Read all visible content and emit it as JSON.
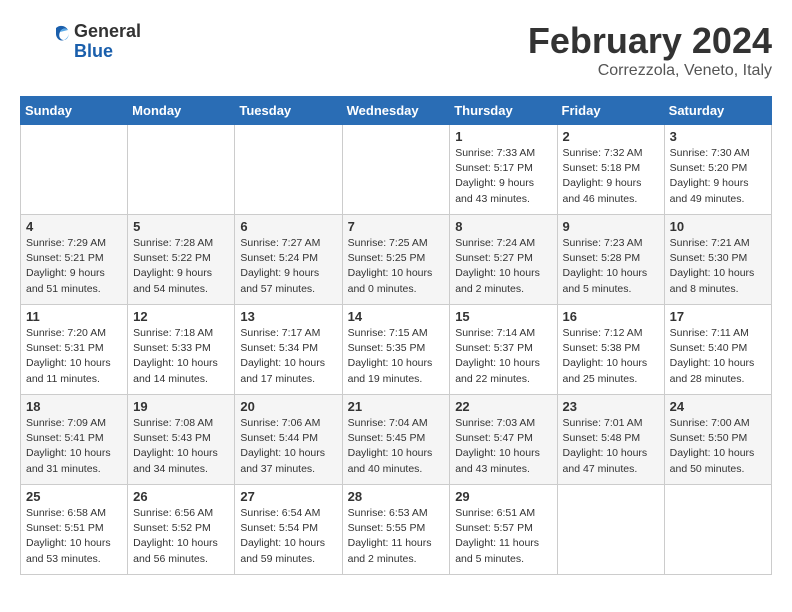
{
  "logo": {
    "general": "General",
    "blue": "Blue"
  },
  "header": {
    "month": "February 2024",
    "location": "Correzzola, Veneto, Italy"
  },
  "weekdays": [
    "Sunday",
    "Monday",
    "Tuesday",
    "Wednesday",
    "Thursday",
    "Friday",
    "Saturday"
  ],
  "weeks": [
    [
      {
        "day": "",
        "detail": ""
      },
      {
        "day": "",
        "detail": ""
      },
      {
        "day": "",
        "detail": ""
      },
      {
        "day": "",
        "detail": ""
      },
      {
        "day": "1",
        "detail": "Sunrise: 7:33 AM\nSunset: 5:17 PM\nDaylight: 9 hours\nand 43 minutes."
      },
      {
        "day": "2",
        "detail": "Sunrise: 7:32 AM\nSunset: 5:18 PM\nDaylight: 9 hours\nand 46 minutes."
      },
      {
        "day": "3",
        "detail": "Sunrise: 7:30 AM\nSunset: 5:20 PM\nDaylight: 9 hours\nand 49 minutes."
      }
    ],
    [
      {
        "day": "4",
        "detail": "Sunrise: 7:29 AM\nSunset: 5:21 PM\nDaylight: 9 hours\nand 51 minutes."
      },
      {
        "day": "5",
        "detail": "Sunrise: 7:28 AM\nSunset: 5:22 PM\nDaylight: 9 hours\nand 54 minutes."
      },
      {
        "day": "6",
        "detail": "Sunrise: 7:27 AM\nSunset: 5:24 PM\nDaylight: 9 hours\nand 57 minutes."
      },
      {
        "day": "7",
        "detail": "Sunrise: 7:25 AM\nSunset: 5:25 PM\nDaylight: 10 hours\nand 0 minutes."
      },
      {
        "day": "8",
        "detail": "Sunrise: 7:24 AM\nSunset: 5:27 PM\nDaylight: 10 hours\nand 2 minutes."
      },
      {
        "day": "9",
        "detail": "Sunrise: 7:23 AM\nSunset: 5:28 PM\nDaylight: 10 hours\nand 5 minutes."
      },
      {
        "day": "10",
        "detail": "Sunrise: 7:21 AM\nSunset: 5:30 PM\nDaylight: 10 hours\nand 8 minutes."
      }
    ],
    [
      {
        "day": "11",
        "detail": "Sunrise: 7:20 AM\nSunset: 5:31 PM\nDaylight: 10 hours\nand 11 minutes."
      },
      {
        "day": "12",
        "detail": "Sunrise: 7:18 AM\nSunset: 5:33 PM\nDaylight: 10 hours\nand 14 minutes."
      },
      {
        "day": "13",
        "detail": "Sunrise: 7:17 AM\nSunset: 5:34 PM\nDaylight: 10 hours\nand 17 minutes."
      },
      {
        "day": "14",
        "detail": "Sunrise: 7:15 AM\nSunset: 5:35 PM\nDaylight: 10 hours\nand 19 minutes."
      },
      {
        "day": "15",
        "detail": "Sunrise: 7:14 AM\nSunset: 5:37 PM\nDaylight: 10 hours\nand 22 minutes."
      },
      {
        "day": "16",
        "detail": "Sunrise: 7:12 AM\nSunset: 5:38 PM\nDaylight: 10 hours\nand 25 minutes."
      },
      {
        "day": "17",
        "detail": "Sunrise: 7:11 AM\nSunset: 5:40 PM\nDaylight: 10 hours\nand 28 minutes."
      }
    ],
    [
      {
        "day": "18",
        "detail": "Sunrise: 7:09 AM\nSunset: 5:41 PM\nDaylight: 10 hours\nand 31 minutes."
      },
      {
        "day": "19",
        "detail": "Sunrise: 7:08 AM\nSunset: 5:43 PM\nDaylight: 10 hours\nand 34 minutes."
      },
      {
        "day": "20",
        "detail": "Sunrise: 7:06 AM\nSunset: 5:44 PM\nDaylight: 10 hours\nand 37 minutes."
      },
      {
        "day": "21",
        "detail": "Sunrise: 7:04 AM\nSunset: 5:45 PM\nDaylight: 10 hours\nand 40 minutes."
      },
      {
        "day": "22",
        "detail": "Sunrise: 7:03 AM\nSunset: 5:47 PM\nDaylight: 10 hours\nand 43 minutes."
      },
      {
        "day": "23",
        "detail": "Sunrise: 7:01 AM\nSunset: 5:48 PM\nDaylight: 10 hours\nand 47 minutes."
      },
      {
        "day": "24",
        "detail": "Sunrise: 7:00 AM\nSunset: 5:50 PM\nDaylight: 10 hours\nand 50 minutes."
      }
    ],
    [
      {
        "day": "25",
        "detail": "Sunrise: 6:58 AM\nSunset: 5:51 PM\nDaylight: 10 hours\nand 53 minutes."
      },
      {
        "day": "26",
        "detail": "Sunrise: 6:56 AM\nSunset: 5:52 PM\nDaylight: 10 hours\nand 56 minutes."
      },
      {
        "day": "27",
        "detail": "Sunrise: 6:54 AM\nSunset: 5:54 PM\nDaylight: 10 hours\nand 59 minutes."
      },
      {
        "day": "28",
        "detail": "Sunrise: 6:53 AM\nSunset: 5:55 PM\nDaylight: 11 hours\nand 2 minutes."
      },
      {
        "day": "29",
        "detail": "Sunrise: 6:51 AM\nSunset: 5:57 PM\nDaylight: 11 hours\nand 5 minutes."
      },
      {
        "day": "",
        "detail": ""
      },
      {
        "day": "",
        "detail": ""
      }
    ]
  ]
}
